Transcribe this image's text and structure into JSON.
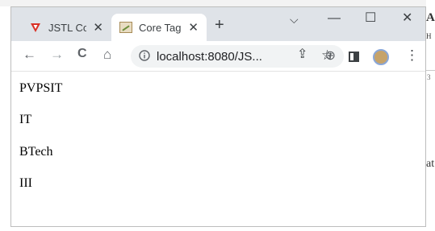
{
  "browser": {
    "tabs": [
      {
        "title": "JSTL Cor",
        "close": "✕",
        "active": false
      },
      {
        "title": "Core Tag",
        "close": "✕",
        "active": true
      }
    ],
    "new_tab": "+",
    "window_controls": {
      "dropdown": "⌵",
      "minimize": "—",
      "maximize": "☐",
      "close": "✕"
    },
    "nav": {
      "back": "←",
      "forward": "→",
      "reload": "C",
      "home": "⌂"
    },
    "url": "localhost:8080/JS...",
    "toolbar_icons": {
      "zoom": "⊕",
      "share": "⇪",
      "bookmark": "☆",
      "menu": "⋮"
    }
  },
  "page": {
    "lines": [
      "PVPSIT",
      "IT",
      "BTech",
      "III"
    ]
  },
  "background": {
    "right_fragments": [
      "A",
      "H",
      "3",
      "at"
    ]
  },
  "colors": {
    "titlebar": "#dfe3e8",
    "favicon_red": "#d93025",
    "omnibox": "#f1f3f4"
  }
}
